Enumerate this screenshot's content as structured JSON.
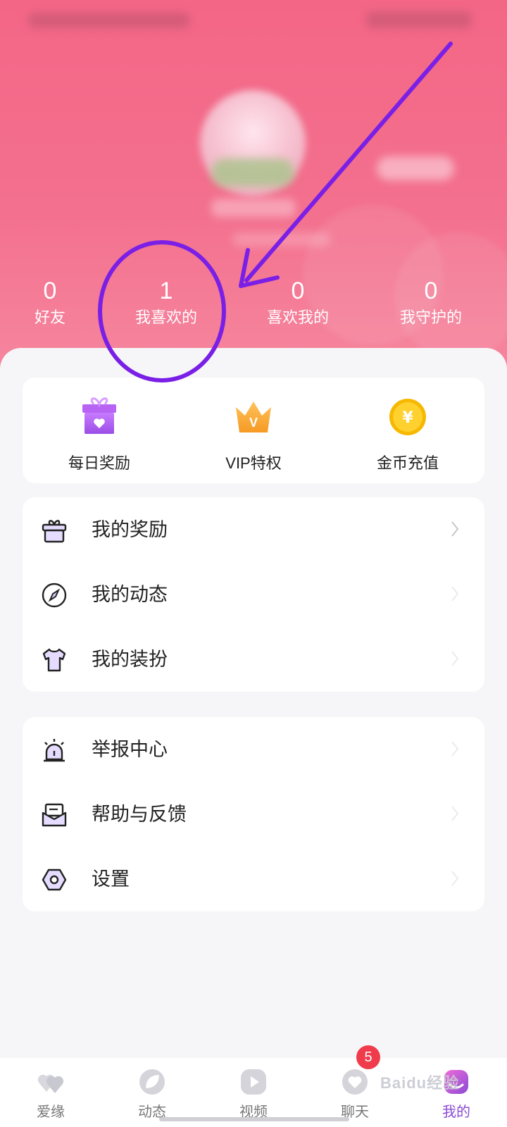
{
  "stats": [
    {
      "value": "0",
      "label": "好友"
    },
    {
      "value": "1",
      "label": "我喜欢的"
    },
    {
      "value": "0",
      "label": "喜欢我的"
    },
    {
      "value": "0",
      "label": "我守护的"
    }
  ],
  "quick_actions": [
    {
      "label": "每日奖励",
      "icon": "gift-box-icon"
    },
    {
      "label": "VIP特权",
      "icon": "crown-icon"
    },
    {
      "label": "金币充值",
      "icon": "gold-coin-icon"
    }
  ],
  "menu_group_1": [
    {
      "label": "我的奖励",
      "icon": "gift-icon"
    },
    {
      "label": "我的动态",
      "icon": "compass-icon"
    },
    {
      "label": "我的装扮",
      "icon": "tshirt-icon"
    }
  ],
  "menu_group_2": [
    {
      "label": "举报中心",
      "icon": "alarm-icon"
    },
    {
      "label": "帮助与反馈",
      "icon": "mail-icon"
    },
    {
      "label": "设置",
      "icon": "settings-icon"
    }
  ],
  "tabs": [
    {
      "label": "爱缘",
      "icon": "hearts-icon"
    },
    {
      "label": "动态",
      "icon": "leaf-icon"
    },
    {
      "label": "视频",
      "icon": "play-icon"
    },
    {
      "label": "聊天",
      "icon": "chat-heart-icon"
    },
    {
      "label": "我的",
      "icon": "profile-icon",
      "active": true
    }
  ],
  "chat_badge": "5",
  "watermark": "Baidu经验",
  "colors": {
    "header_pink": "#f46686",
    "accent_purple": "#8a4bd6",
    "annotation_purple": "#7a1fe6",
    "badge_red": "#ef3b4c"
  }
}
